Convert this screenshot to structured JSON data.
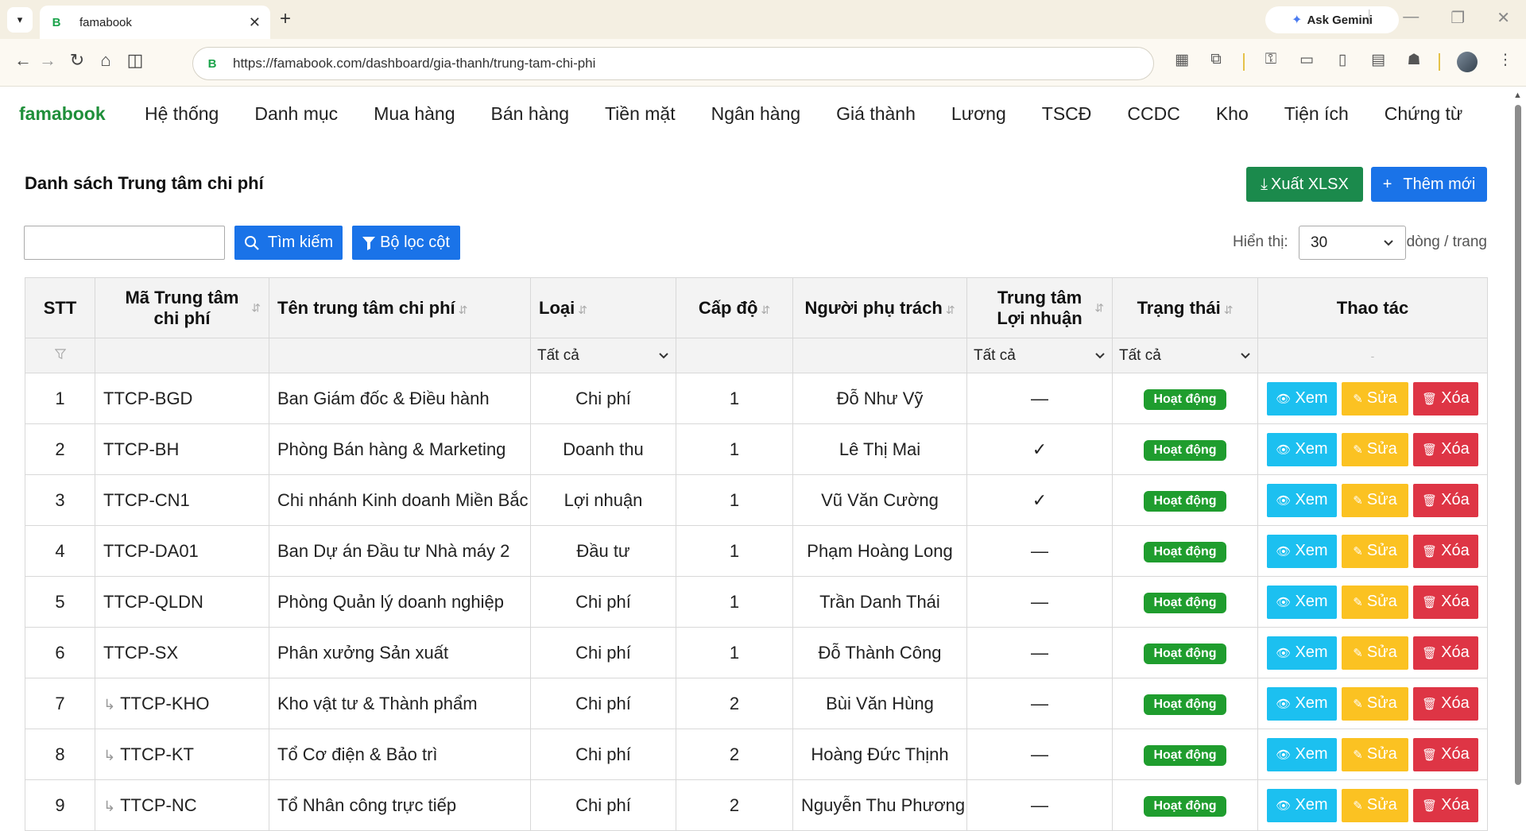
{
  "browser": {
    "tab_title": "famabook",
    "url": "https://famabook.com/dashboard/gia-thanh/trung-tam-chi-phi",
    "gemini_label": "Ask Gemini"
  },
  "app": {
    "brand": "famabook",
    "menu": [
      "Hệ thống",
      "Danh mục",
      "Mua hàng",
      "Bán hàng",
      "Tiền mặt",
      "Ngân hàng",
      "Giá thành",
      "Lương",
      "TSCĐ",
      "CCDC",
      "Kho",
      "Tiện ích",
      "Chứng từ"
    ]
  },
  "page": {
    "title": "Danh sách Trung tâm chi phí",
    "export_label": "Xuất XLSX",
    "add_label": "Thêm mới",
    "search_label": "Tìm kiếm",
    "filter_label": "Bộ lọc cột",
    "search_value": "",
    "show_label": "Hiển thị:",
    "page_size": "30",
    "rows_label": "dòng / trang"
  },
  "table": {
    "headers": {
      "stt": "STT",
      "code": "Mã Trung tâm chi phí",
      "name": "Tên trung tâm chi phí",
      "type": "Loại",
      "level": "Cấp độ",
      "owner": "Người phụ trách",
      "profit": "Trung tâm Lợi nhuận",
      "status": "Trạng thái",
      "actions": "Thao tác"
    },
    "filters": {
      "type": "Tất cả",
      "profit": "Tất cả",
      "status": "Tất cả",
      "actions": "-"
    },
    "action_labels": {
      "view": "Xem",
      "edit": "Sửa",
      "delete": "Xóa"
    },
    "rows": [
      {
        "stt": "1",
        "code": "TTCP-BGD",
        "child": false,
        "name": "Ban Giám đốc & Điều hành",
        "type": "Chi phí",
        "level": "1",
        "owner": "Đỗ Như Vỹ",
        "profit": "—",
        "status": "Hoạt động"
      },
      {
        "stt": "2",
        "code": "TTCP-BH",
        "child": false,
        "name": "Phòng Bán hàng & Marketing",
        "type": "Doanh thu",
        "level": "1",
        "owner": "Lê Thị Mai",
        "profit": "✓",
        "status": "Hoạt động"
      },
      {
        "stt": "3",
        "code": "TTCP-CN1",
        "child": false,
        "name": "Chi nhánh Kinh doanh Miền Bắc",
        "type": "Lợi nhuận",
        "level": "1",
        "owner": "Vũ Văn Cường",
        "profit": "✓",
        "status": "Hoạt động"
      },
      {
        "stt": "4",
        "code": "TTCP-DA01",
        "child": false,
        "name": "Ban Dự án Đầu tư Nhà máy 2",
        "type": "Đầu tư",
        "level": "1",
        "owner": "Phạm Hoàng Long",
        "profit": "—",
        "status": "Hoạt động"
      },
      {
        "stt": "5",
        "code": "TTCP-QLDN",
        "child": false,
        "name": "Phòng Quản lý doanh nghiệp",
        "type": "Chi phí",
        "level": "1",
        "owner": "Trần Danh Thái",
        "profit": "—",
        "status": "Hoạt động"
      },
      {
        "stt": "6",
        "code": "TTCP-SX",
        "child": false,
        "name": "Phân xưởng Sản xuất",
        "type": "Chi phí",
        "level": "1",
        "owner": "Đỗ Thành Công",
        "profit": "—",
        "status": "Hoạt động"
      },
      {
        "stt": "7",
        "code": "TTCP-KHO",
        "child": true,
        "name": "Kho vật tư & Thành phẩm",
        "type": "Chi phí",
        "level": "2",
        "owner": "Bùi Văn Hùng",
        "profit": "—",
        "status": "Hoạt động"
      },
      {
        "stt": "8",
        "code": "TTCP-KT",
        "child": true,
        "name": "Tổ Cơ điện & Bảo trì",
        "type": "Chi phí",
        "level": "2",
        "owner": "Hoàng Đức Thịnh",
        "profit": "—",
        "status": "Hoạt động"
      },
      {
        "stt": "9",
        "code": "TTCP-NC",
        "child": true,
        "name": "Tổ Nhân công trực tiếp",
        "type": "Chi phí",
        "level": "2",
        "owner": "Nguyễn Thu Phương",
        "profit": "—",
        "status": "Hoạt động"
      }
    ]
  },
  "colors": {
    "brand_green": "#1f8f3a",
    "primary_blue": "#1a73e8",
    "export_green": "#1b8a4c",
    "view_cyan": "#1cc0f0",
    "edit_yellow": "#fbc222",
    "delete_red": "#de3545",
    "status_green": "#1f9d2e"
  }
}
